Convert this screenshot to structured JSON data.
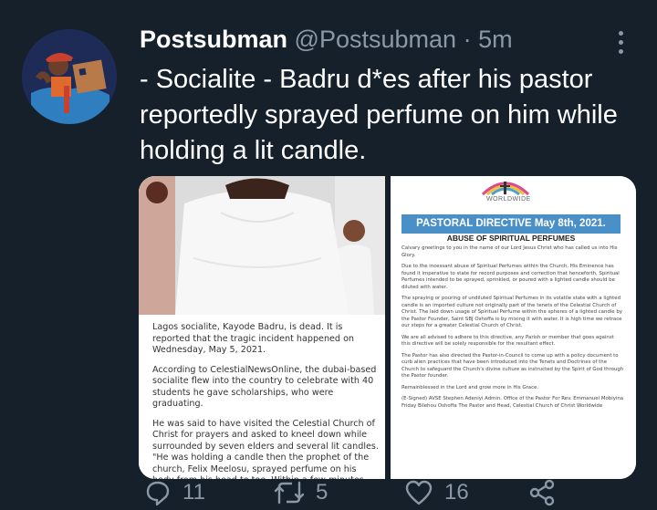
{
  "tweet": {
    "display_name": "Postsubman",
    "handle": "@Postsubman",
    "separator": "·",
    "time": "5m",
    "text": "- Socialite - Badru d*es after his pastor reportedly sprayed perfume on him while holding a lit candle."
  },
  "media": {
    "article_paragraphs": [
      "Lagos socialite, Kayode Badru, is dead. It is reported that the tragic incident happened on Wednesday, May 5, 2021.",
      "According to CelestialNewsOnline, the dubai-based socialite flew into the country to celebrate with 40 students he gave scholarships, who were graduating.",
      "He was said to have visited the Celestial Church of Christ for prayers and asked to kneel down while surrounded by seven elders and several lit candles. \"He was holding a candle then the prophet of the church, Felix Meelosu, sprayed perfume on his body from his head to toe. Within a few minutes, his body caught fire, he suffered severe"
    ],
    "doc_header": "WORLDWIDE",
    "doc_title": "PASTORAL DIRECTIVE May 8th, 2021.",
    "doc_subtitle": "ABUSE OF SPIRITUAL PERFUMES",
    "doc_paragraphs": [
      "Calvary greetings to you in the name of our Lord Jesus Christ who has called us into His Glory.",
      "Due to the incessant abuse of Spiritual Perfumes within the Church, His Eminence has found it imperative to state for record purposes and correction that henceforth, Spiritual Perfumes intended to be sprayed, sprinkled, or poured with a lighted candle should be diluted with water.",
      "The spraying or pouring of undiluted Spiritual Perfumes in its volatile state with a lighted candle is an imported culture not originally part of the tenets of the Celestial Church of Christ. The laid down usage of Spiritual Perfume within the spheres of a lighted candle by the Pastor Founder, Saint SBJ Oshoffa is by mixing it with water. It is high time we retrace our steps for a greater Celestial Church of Christ.",
      "We are all advised to adhere to this directive, any Parish or member that goes against this directive will be solely responsible for the resultant effect.",
      "The Pastor has also directed the Pastor-in-Council to come up with a policy document to curb alien practices that have been introduced into the Tenets and Doctrines of the Church to safeguard the Church's divine culture as instructed by the Spirit of God through the Pastor founder.",
      "Remainblessed in the Lord and grow more in His Grace.",
      "(E-Signed) AVSE Stephen Adeniyi Admin. Office of the Pastor For Rev. Emmanuel Mobiyina Friday Bilehou Oshoffa The Pastor and Head, Celestial Church of Christ Worldwide"
    ]
  },
  "actions": {
    "reply_count": "11",
    "retweet_count": "5",
    "like_count": "16"
  },
  "colors": {
    "background": "#15202b",
    "secondary_text": "#8b98a5",
    "directive_banner": "#4a90c8"
  },
  "icons": [
    "avatar-illustration",
    "more-icon",
    "reply-icon",
    "retweet-icon",
    "like-icon",
    "share-icon"
  ]
}
